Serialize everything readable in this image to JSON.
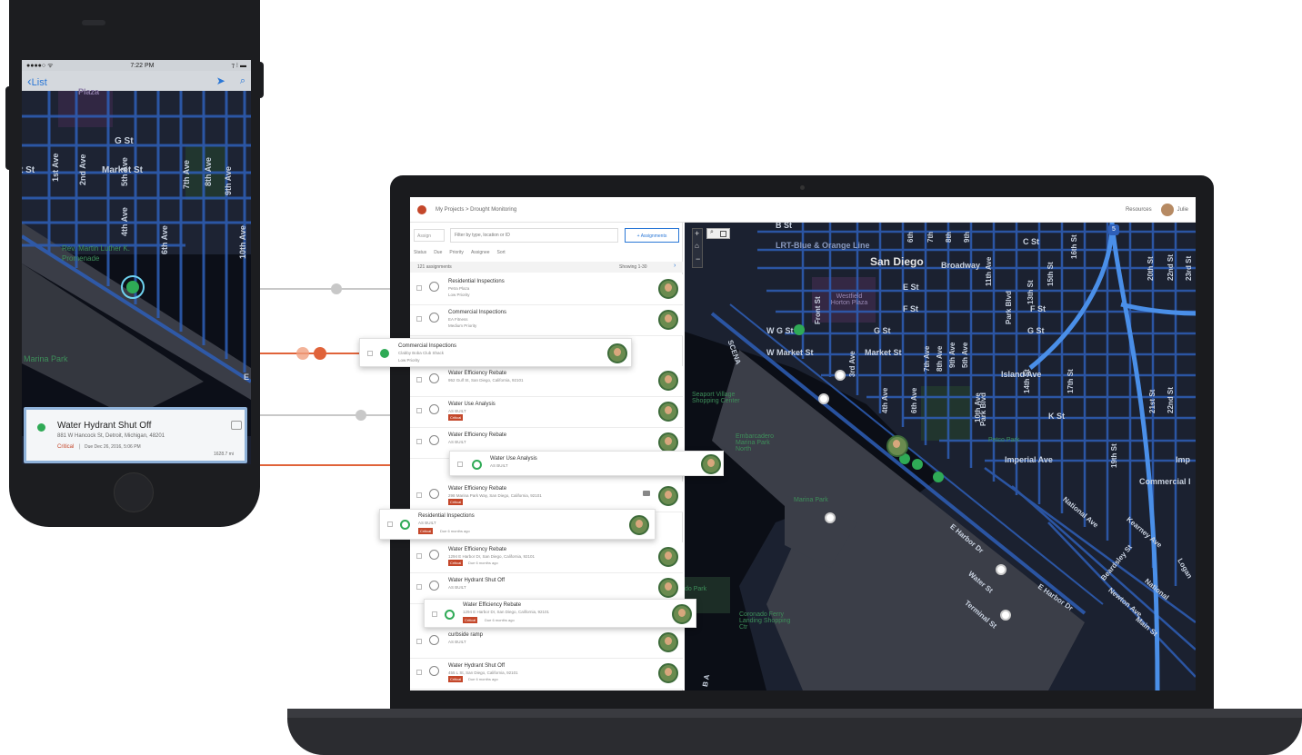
{
  "phone": {
    "status": {
      "carrier": "●●●●○ ᯤ",
      "time": "7:22 PM",
      "battery": "⁊ ⁝ ▬"
    },
    "nav": {
      "back_label": "List"
    },
    "map_labels": {
      "plaza": "Plaza",
      "g_st": "G St",
      "market_st": "Market St",
      "t_st": "t St",
      "first_ave": "1st Ave",
      "second_ave": "2nd Ave",
      "fourth_ave": "4th Ave",
      "fifth_ave": "5th Ave",
      "sixth_ave": "6th Ave",
      "seventh_ave": "7th Ave",
      "eighth_ave": "8th Ave",
      "ninth_ave": "9th Ave",
      "tenth_ave": "10th Ave",
      "mlk": "Rev. Martin Luther K. Promenade",
      "marina_park": "Marina Park",
      "e": "E"
    },
    "card": {
      "title": "Water Hydrant Shut Off",
      "address": "881 W Hancock St, Detroit, Michigan, 48201",
      "status": "Critical",
      "due": "Due Dec 26, 2016, 5:06 PM",
      "distance": "1628.7 mi"
    }
  },
  "laptop": {
    "header": {
      "breadcrumb": "My Projects > Drought Monitoring",
      "resources": "Resources",
      "user": "Julie"
    },
    "toolbar": {
      "assign_label": "Assign",
      "filter_placeholder": "Filter by type, location or ID",
      "assignments_button": "+ Assignments"
    },
    "filters": [
      "Status",
      "Due",
      "Priority",
      "Assignee",
      "Sort"
    ],
    "list_meta": {
      "count": "121 assignments",
      "showing": "Showing 1-30"
    },
    "rows": [
      {
        "title": "Residential Inspections",
        "sub": "Petra Plaza",
        "priority": "Low Priority"
      },
      {
        "title": "Commercial Inspections",
        "sub": "EA Fitness",
        "priority": "Medium Priority"
      },
      {
        "title": "Water Efficiency Rebate",
        "sub": "952 Gulf St, San Diego, California, 92101",
        "priority": ""
      },
      {
        "title": "Water Use Analysis",
        "sub": "AS BUILT",
        "badge": "Critical"
      },
      {
        "title": "Water Efficiency Rebate",
        "sub": "AS BUILT",
        "priority": ""
      },
      {
        "title": "Water Efficiency Rebate",
        "sub": "298 Marina Park Way, San Diego, California, 92101",
        "badge": "Critical"
      },
      {
        "title": "Water Efficiency Rebate",
        "sub": "1294 E Harbor Dr, San Diego, California, 92101",
        "badge": "Critical",
        "due": "Due 6 months ago"
      },
      {
        "title": "Water Hydrant Shut Off",
        "sub": "AS BUILT",
        "priority": ""
      },
      {
        "title": "curbside ramp",
        "sub": "AS BUILT",
        "priority": ""
      },
      {
        "title": "Water Hydrant Shut Off",
        "sub": "455 L St, San Diego, California, 92101",
        "badge": "Critical",
        "due": "Due 6 months ago"
      }
    ],
    "popups": {
      "commercial": {
        "title": "Commercial Inspections",
        "sub": "Clabby Boba Club Shack",
        "priority": "Low Priority"
      },
      "water_use": {
        "title": "Water Use Analysis",
        "sub": "AS BUILT"
      },
      "residential": {
        "title": "Residential Inspections",
        "sub": "AS BUILT",
        "badge": "Critical",
        "due": "Due 6 months ago"
      },
      "water_eff": {
        "title": "Water Efficiency Rebate",
        "sub": "1294 E Harbor Dr, San Diego, California, 92101",
        "badge": "Critical",
        "due": "Due 6 months ago"
      }
    },
    "map_labels": {
      "b_st": "B St",
      "lrt": "LRT-Blue & Orange Line",
      "c_st": "C St",
      "san_diego": "San Diego",
      "broadway": "Broadway",
      "e_st": "E St",
      "f_st": "F St",
      "f_st2": "F St",
      "g_st": "G St",
      "g_st2": "G St",
      "w_g_st": "W G St",
      "w_market_st": "W Market St",
      "market_st": "Market St",
      "island_ave": "Island Ave",
      "k_st": "K St",
      "imperial_ave": "Imperial Ave",
      "imp": "Imp",
      "commercial": "Commercial I",
      "westfield": "Westfield Horton Plaza",
      "seaport": "Seaport Village Shopping Center",
      "embarcadero": "Embarcadero Marina Park North",
      "marina_park": "Marina Park",
      "petco": "Petco Park",
      "coronado": "Coronado Ferry Landing Shopping Ctr",
      "do_park": "do Park",
      "harbor": "E Harbor Dr",
      "harbor2": "E Harbor Dr",
      "water_st": "Water St",
      "terminal_st": "Terminal St",
      "national_ave": "National Ave",
      "national2": "National",
      "newton_ave": "Newton Ave",
      "main_st": "Main St",
      "beardsley": "Beardsley St",
      "kearney": "Kearney Ave",
      "logan": "Logan",
      "front_st": "Front St",
      "park_blvd": "Park Blvd",
      "park_blvd2": "Park Blvd",
      "eleventh_ave": "11th Ave",
      "thirteenth_st": "13th St",
      "fourteenth_st": "14th St",
      "fifteenth_st": "15th St",
      "sixteenth_st": "16th St",
      "seventeenth_st": "17th St",
      "nineteenth_st": "19th St",
      "twentieth_st": "20th St",
      "twentyfirst_st": "21st St",
      "twentysecond_st": "22nd St",
      "twentythird_st": "23rd St",
      "fourth_ave": "4th Ave",
      "sixth_ave": "6th Ave",
      "seventh_ave": "7th Ave",
      "eighth_ave": "8th Ave",
      "ninth_ave": "9th Ave",
      "tenth_ave": "10th Ave",
      "fifth_ave": "5th Ave",
      "third_ave": "3rd Ave",
      "seventh": "7th",
      "eighth": "8th",
      "ninth": "9th",
      "sixth": "6th",
      "b_a": "B A",
      "scena": "SCENA",
      "five": "5"
    }
  },
  "colors": {
    "accent_green": "#2faa56",
    "critical_red": "#c4472a",
    "connector_orange": "#e0633a",
    "map_street_blue": "#2e5fb8",
    "map_bg": "#1a1f2d",
    "link_blue": "#2a77d6"
  },
  "icons": [
    "location-arrow-icon",
    "search-icon",
    "zoom-in-icon",
    "zoom-out-icon",
    "home-icon",
    "chat-icon",
    "user-avatar"
  ]
}
